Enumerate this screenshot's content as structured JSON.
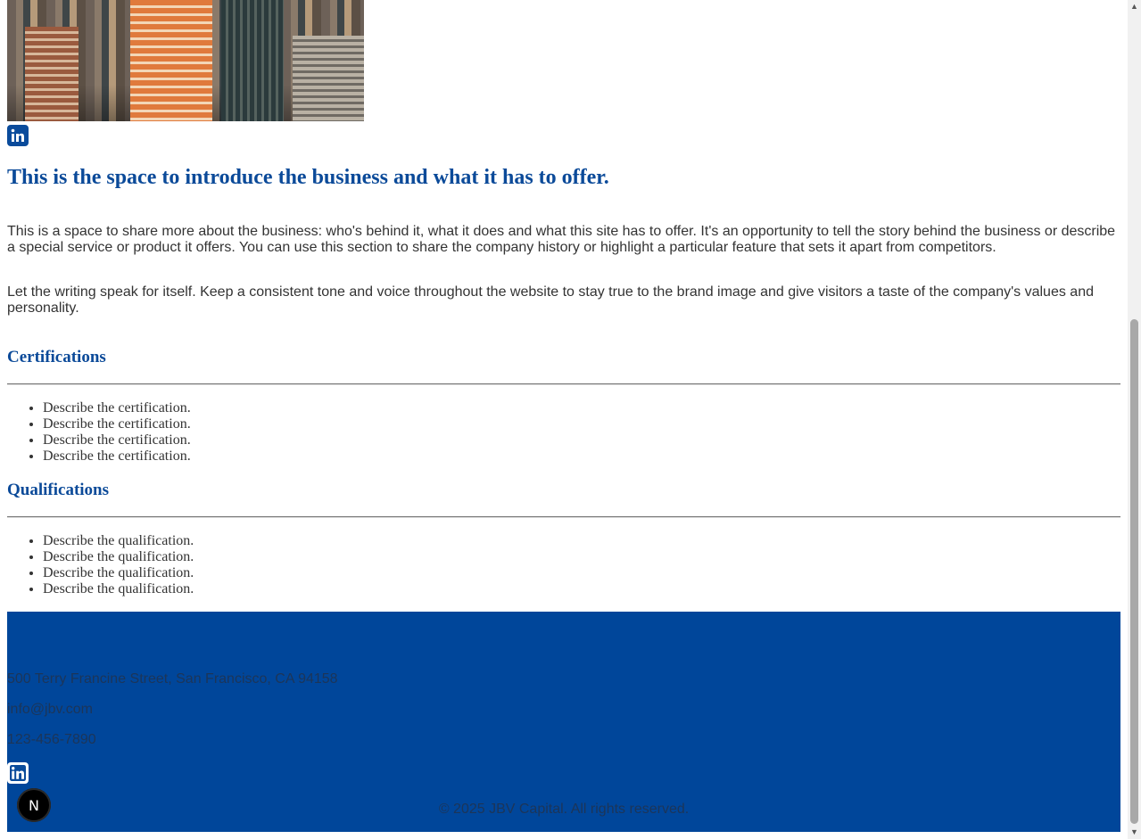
{
  "intro": {
    "heading": "This is the space to introduce the business and what it has to offer.",
    "paragraph1": "This is a space to share more about the business: who's behind it, what it does and what this site has to offer. It's an opportunity to tell the story behind the business or describe a special service or product it offers. You can use this section to share the company history or highlight a particular feature that sets it apart from competitors.",
    "paragraph2": "Let the writing speak for itself. Keep a consistent tone and voice throughout the website to stay true to the brand image and give visitors a taste of the company's values and personality."
  },
  "certifications": {
    "heading": "Certifications",
    "items": [
      "Describe the certification.",
      "Describe the certification.",
      "Describe the certification.",
      "Describe the certification."
    ]
  },
  "qualifications": {
    "heading": "Qualifications",
    "items": [
      "Describe the qualification.",
      "Describe the qualification.",
      "Describe the qualification.",
      "Describe the qualification."
    ]
  },
  "footer": {
    "address": "500 Terry Francine Street, San Francisco, CA 94158",
    "email": "info@jbv.com",
    "phone": "123-456-7890",
    "copyright": "© 2025 JBV Capital. All rights reserved."
  },
  "badge": {
    "letter": "N"
  },
  "icons": {
    "linkedin": "linkedin-icon",
    "badge": "n-logo-icon"
  },
  "colors": {
    "brand_blue": "#0b4a99",
    "footer_bg": "#00469a"
  }
}
